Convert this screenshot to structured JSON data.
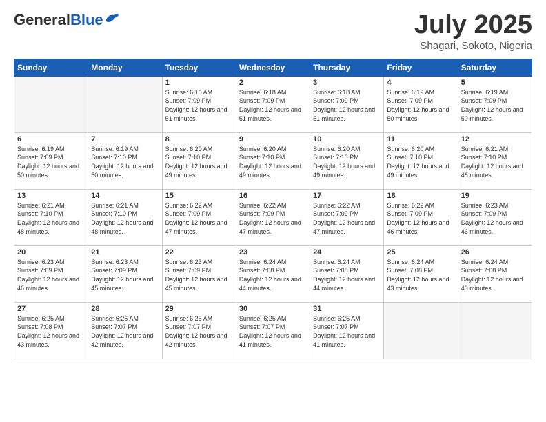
{
  "header": {
    "logo_general": "General",
    "logo_blue": "Blue",
    "month_title": "July 2025",
    "location": "Shagari, Sokoto, Nigeria"
  },
  "weekdays": [
    "Sunday",
    "Monday",
    "Tuesday",
    "Wednesday",
    "Thursday",
    "Friday",
    "Saturday"
  ],
  "weeks": [
    [
      {
        "num": "",
        "info": ""
      },
      {
        "num": "",
        "info": ""
      },
      {
        "num": "1",
        "info": "Sunrise: 6:18 AM\nSunset: 7:09 PM\nDaylight: 12 hours and 51 minutes."
      },
      {
        "num": "2",
        "info": "Sunrise: 6:18 AM\nSunset: 7:09 PM\nDaylight: 12 hours and 51 minutes."
      },
      {
        "num": "3",
        "info": "Sunrise: 6:18 AM\nSunset: 7:09 PM\nDaylight: 12 hours and 51 minutes."
      },
      {
        "num": "4",
        "info": "Sunrise: 6:19 AM\nSunset: 7:09 PM\nDaylight: 12 hours and 50 minutes."
      },
      {
        "num": "5",
        "info": "Sunrise: 6:19 AM\nSunset: 7:09 PM\nDaylight: 12 hours and 50 minutes."
      }
    ],
    [
      {
        "num": "6",
        "info": "Sunrise: 6:19 AM\nSunset: 7:09 PM\nDaylight: 12 hours and 50 minutes."
      },
      {
        "num": "7",
        "info": "Sunrise: 6:19 AM\nSunset: 7:10 PM\nDaylight: 12 hours and 50 minutes."
      },
      {
        "num": "8",
        "info": "Sunrise: 6:20 AM\nSunset: 7:10 PM\nDaylight: 12 hours and 49 minutes."
      },
      {
        "num": "9",
        "info": "Sunrise: 6:20 AM\nSunset: 7:10 PM\nDaylight: 12 hours and 49 minutes."
      },
      {
        "num": "10",
        "info": "Sunrise: 6:20 AM\nSunset: 7:10 PM\nDaylight: 12 hours and 49 minutes."
      },
      {
        "num": "11",
        "info": "Sunrise: 6:20 AM\nSunset: 7:10 PM\nDaylight: 12 hours and 49 minutes."
      },
      {
        "num": "12",
        "info": "Sunrise: 6:21 AM\nSunset: 7:10 PM\nDaylight: 12 hours and 48 minutes."
      }
    ],
    [
      {
        "num": "13",
        "info": "Sunrise: 6:21 AM\nSunset: 7:10 PM\nDaylight: 12 hours and 48 minutes."
      },
      {
        "num": "14",
        "info": "Sunrise: 6:21 AM\nSunset: 7:10 PM\nDaylight: 12 hours and 48 minutes."
      },
      {
        "num": "15",
        "info": "Sunrise: 6:22 AM\nSunset: 7:09 PM\nDaylight: 12 hours and 47 minutes."
      },
      {
        "num": "16",
        "info": "Sunrise: 6:22 AM\nSunset: 7:09 PM\nDaylight: 12 hours and 47 minutes."
      },
      {
        "num": "17",
        "info": "Sunrise: 6:22 AM\nSunset: 7:09 PM\nDaylight: 12 hours and 47 minutes."
      },
      {
        "num": "18",
        "info": "Sunrise: 6:22 AM\nSunset: 7:09 PM\nDaylight: 12 hours and 46 minutes."
      },
      {
        "num": "19",
        "info": "Sunrise: 6:23 AM\nSunset: 7:09 PM\nDaylight: 12 hours and 46 minutes."
      }
    ],
    [
      {
        "num": "20",
        "info": "Sunrise: 6:23 AM\nSunset: 7:09 PM\nDaylight: 12 hours and 46 minutes."
      },
      {
        "num": "21",
        "info": "Sunrise: 6:23 AM\nSunset: 7:09 PM\nDaylight: 12 hours and 45 minutes."
      },
      {
        "num": "22",
        "info": "Sunrise: 6:23 AM\nSunset: 7:09 PM\nDaylight: 12 hours and 45 minutes."
      },
      {
        "num": "23",
        "info": "Sunrise: 6:24 AM\nSunset: 7:08 PM\nDaylight: 12 hours and 44 minutes."
      },
      {
        "num": "24",
        "info": "Sunrise: 6:24 AM\nSunset: 7:08 PM\nDaylight: 12 hours and 44 minutes."
      },
      {
        "num": "25",
        "info": "Sunrise: 6:24 AM\nSunset: 7:08 PM\nDaylight: 12 hours and 43 minutes."
      },
      {
        "num": "26",
        "info": "Sunrise: 6:24 AM\nSunset: 7:08 PM\nDaylight: 12 hours and 43 minutes."
      }
    ],
    [
      {
        "num": "27",
        "info": "Sunrise: 6:25 AM\nSunset: 7:08 PM\nDaylight: 12 hours and 43 minutes."
      },
      {
        "num": "28",
        "info": "Sunrise: 6:25 AM\nSunset: 7:07 PM\nDaylight: 12 hours and 42 minutes."
      },
      {
        "num": "29",
        "info": "Sunrise: 6:25 AM\nSunset: 7:07 PM\nDaylight: 12 hours and 42 minutes."
      },
      {
        "num": "30",
        "info": "Sunrise: 6:25 AM\nSunset: 7:07 PM\nDaylight: 12 hours and 41 minutes."
      },
      {
        "num": "31",
        "info": "Sunrise: 6:25 AM\nSunset: 7:07 PM\nDaylight: 12 hours and 41 minutes."
      },
      {
        "num": "",
        "info": ""
      },
      {
        "num": "",
        "info": ""
      }
    ]
  ]
}
